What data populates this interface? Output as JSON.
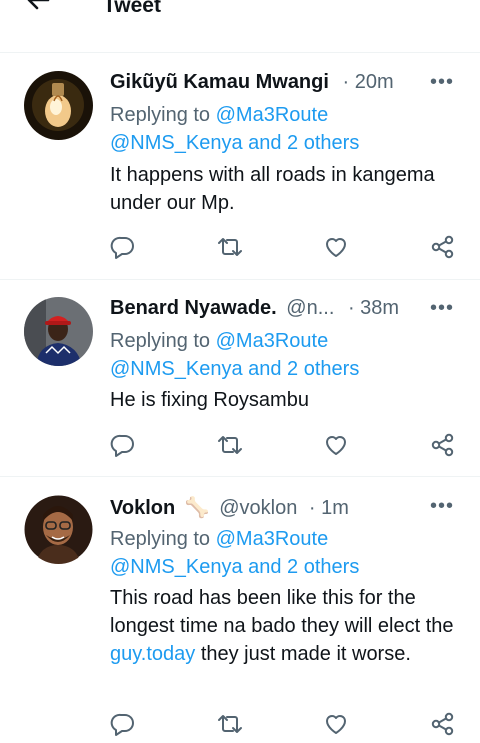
{
  "header": {
    "title": "Tweet"
  },
  "tweets": [
    {
      "name": "Gikũyũ Kamau Mwangi",
      "handle": "",
      "time": "· 20m",
      "replying_prefix": "Replying to",
      "replying_line1": "@Ma3Route",
      "replying_line2": "@NMS_Kenya and 2 others",
      "text": "It happens with all roads in kangema under our Mp.",
      "avatar_icon": "lightbulb-avatar"
    },
    {
      "name": "Benard Nyawade.",
      "handle": "@n...",
      "time": "· 38m",
      "replying_prefix": "Replying to",
      "replying_line1": "@Ma3Route",
      "replying_line2": "@NMS_Kenya and 2 others",
      "text": "He is fixing Roysambu",
      "avatar_icon": "person-red-cap-avatar"
    },
    {
      "name": "Voklon",
      "emoji": "🦴",
      "handle": "@voklon",
      "time": "· 1m",
      "replying_prefix": "Replying to",
      "replying_line1": "@Ma3Route",
      "replying_line2": "@NMS_Kenya and 2 others",
      "text_before": "This road has been like this for the longest time na bado they will elect the",
      "link": "guy.today",
      "text_after": "they just made it worse.",
      "avatar_icon": "memoji-avatar"
    }
  ],
  "actions": [
    "reply-icon",
    "retweet-icon",
    "like-icon",
    "share-icon"
  ],
  "colors": {
    "accent": "#1d9bf0",
    "muted": "#536471",
    "text": "#0f1419",
    "divider": "#eff3f4"
  }
}
